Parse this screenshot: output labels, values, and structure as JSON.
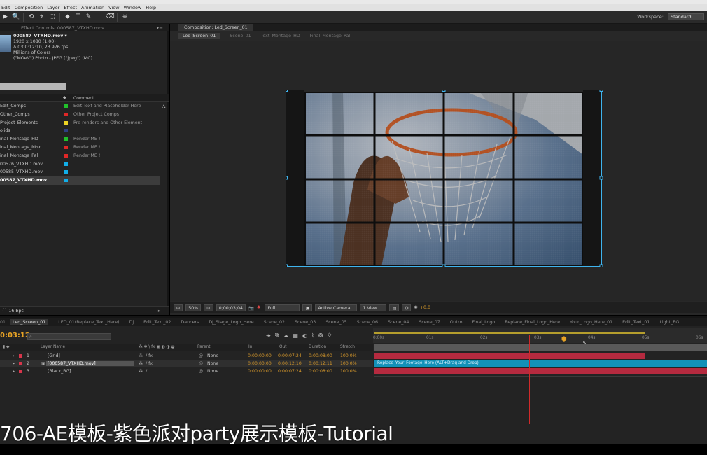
{
  "menu": [
    "Edit",
    "Composition",
    "Layer",
    "Effect",
    "Animation",
    "View",
    "Window",
    "Help"
  ],
  "toolbar": {
    "tools": [
      "▶",
      "🔍",
      "⟲",
      "⌖",
      "⬚",
      "⬥",
      "T",
      "✎",
      "⊥",
      "⌫",
      "⎈"
    ],
    "workspace_label": "Workspace:",
    "workspace_value": "Standard"
  },
  "left_panel": {
    "tab_title": "Effect Controls: 000587_VTXHD.mov",
    "footage": {
      "name": "000587_VTXHD.mov ▾",
      "resolution": "1920 x 1080 (1.00)",
      "duration": "Δ 0:00:12:10, 23.976 fps",
      "colors": "Millions of Colors",
      "codec": "(\"MOeV\") Photo - JPEG (\"jpeg\") (MC)"
    },
    "columns": {
      "name": "Name",
      "comment": "Comment"
    },
    "items": [
      {
        "name": "Edit_Comps",
        "label_color": "#21c12b",
        "comment": "Edit Text and Placeholder Here"
      },
      {
        "name": "Other_Comps",
        "label_color": "#e02727",
        "comment": "Other Project Comps"
      },
      {
        "name": "Project_Elements",
        "label_color": "#ecd325",
        "comment": "Pre-renders and Other Element"
      },
      {
        "name": "olids",
        "label_color": "#2e3f82",
        "comment": ""
      },
      {
        "name": "inal_Montage_HD",
        "label_color": "#21c12b",
        "comment": "Render ME !"
      },
      {
        "name": "inal_Montage_Ntsc",
        "label_color": "#e02727",
        "comment": "Render ME !"
      },
      {
        "name": "inal_Montage_Pal",
        "label_color": "#e02727",
        "comment": "Render ME !"
      },
      {
        "name": "00576_VTXHD.mov",
        "label_color": "#12aee8",
        "comment": ""
      },
      {
        "name": "00585_VTXHD.mov",
        "label_color": "#12aee8",
        "comment": ""
      },
      {
        "name": "00587_VTXHD.mov",
        "label_color": "#12aee8",
        "comment": ""
      }
    ],
    "bpc": "16 bpc"
  },
  "comp_panel": {
    "tab_title": "Composition: Led_Screen_01",
    "sub_tabs": [
      "Led_Screen_01",
      "Scene_01",
      "Text_Montage_HD",
      "Final_Montage_Pal"
    ],
    "footer": {
      "zoom": "50%",
      "timecode": "0;00;03;04",
      "resolution": "Full",
      "camera": "Active Camera",
      "views": "1 View",
      "exposure": "+0.0"
    }
  },
  "timeline": {
    "tabs": [
      "Led_Screen_01",
      "LED_01(Replace_Text_Here)",
      "Dj",
      "Edit_Text_02",
      "Dancers",
      "Dj_Stage_Logo_Here",
      "Scene_02",
      "Scene_03",
      "Scene_05",
      "Scene_06",
      "Scene_04",
      "Scene_07",
      "Outro",
      "Final_Logo",
      "Replace_Final_Logo_Here",
      "Your_Logo_Here_01",
      "Edit_Text_01",
      "Light_BG"
    ],
    "timecode": "0:03:12",
    "headers": {
      "layer_name": "Layer Name",
      "parent": "Parent",
      "in": "In",
      "out": "Out",
      "duration": "Duration",
      "stretch": "Stretch"
    },
    "layers": [
      {
        "num": "1",
        "name": "[Grid]",
        "label_color": "#d8354b",
        "parent": "None",
        "in": "0:00:00:00",
        "out": "0:00:07:24",
        "duration": "0:00:08:00",
        "stretch": "100.0%"
      },
      {
        "num": "2",
        "name": "[000587_VTXHD.mov]",
        "label_color": "#d8354b",
        "parent": "None",
        "in": "0:00:00:00",
        "out": "0:00:12:10",
        "duration": "0:00:12:11",
        "stretch": "100.0%"
      },
      {
        "num": "3",
        "name": "[Black_BG]",
        "label_color": "#d8354b",
        "parent": "None",
        "in": "0:00:00:00",
        "out": "0:00:07:24",
        "duration": "0:00:08:00",
        "stretch": "100.0%"
      }
    ],
    "ruler_ticks": [
      "0:00s",
      "01s",
      "02s",
      "03s",
      "04s",
      "05s",
      "06s"
    ],
    "layer2_bar_text": "Replace_Your_Footage_Here   (ALT+Drag and Drop)",
    "current_time_fraction": 0.466
  },
  "subtitle": "706-AE模板-紫色派对party展示模板-Tutorial"
}
